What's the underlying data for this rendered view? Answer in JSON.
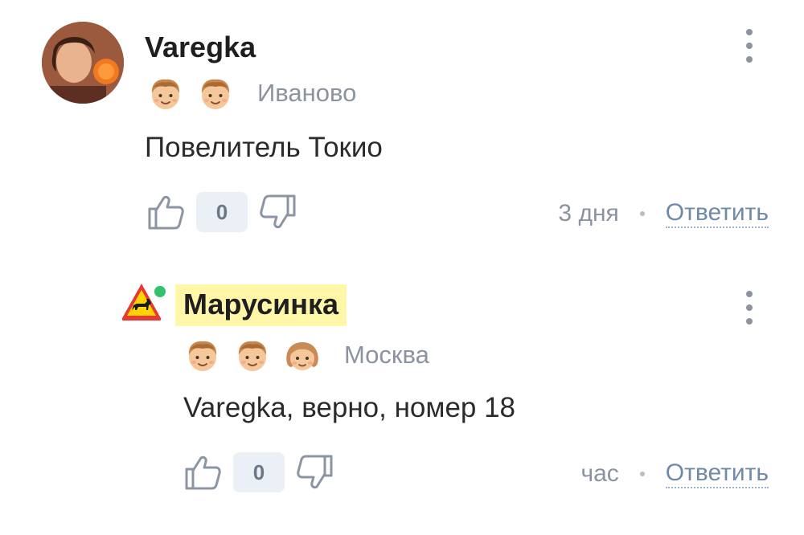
{
  "comments": [
    {
      "author": "Varegka",
      "city": "Иваново",
      "text": "Повелитель Токио",
      "score": "0",
      "time": "3 дня",
      "reply_label": "Ответить",
      "badges": [
        "boy-badge-icon",
        "boy-badge-icon"
      ],
      "online": false
    },
    {
      "author": "Марусинка",
      "city": "Москва",
      "text": "Varegka, верно, номер 18",
      "score": "0",
      "time": "час",
      "reply_label": "Ответить",
      "badges": [
        "boy-badge-icon",
        "boy-badge-icon",
        "girl-badge-icon"
      ],
      "online": true,
      "author_highlight": "#fff6a8"
    }
  ],
  "colors": {
    "meta_gray": "#8b93a1",
    "reply_link": "#6f8aa6",
    "score_bg": "#eaf0f6",
    "online_green": "#2fc36d"
  }
}
